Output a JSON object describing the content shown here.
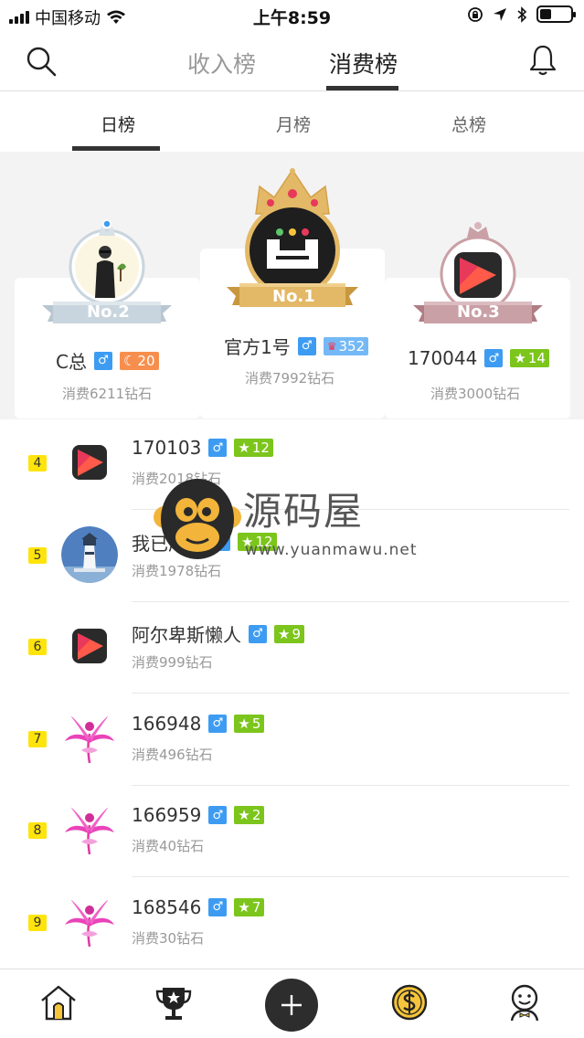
{
  "status_bar": {
    "carrier": "中国移动",
    "time": "上午8:59"
  },
  "header": {
    "tabs": [
      {
        "label": "收入榜"
      },
      {
        "label": "消费榜"
      }
    ],
    "active_tab": 1
  },
  "sub_tabs": [
    {
      "label": "日榜"
    },
    {
      "label": "月榜"
    },
    {
      "label": "总榜"
    }
  ],
  "podium": [
    {
      "rank_label": "No.1",
      "name": "官方1号",
      "gender": "♂",
      "level": "352",
      "level_color": "#74b9f6",
      "spend": "消费7992钻石"
    },
    {
      "rank_label": "No.2",
      "name": "C总",
      "gender": "♂",
      "level": "20",
      "level_color": "#f68f4d",
      "spend": "消费6211钻石"
    },
    {
      "rank_label": "No.3",
      "name": "170044",
      "gender": "♂",
      "level": "14",
      "level_color": "#7cc51c",
      "spend": "消费3000钻石"
    }
  ],
  "list": [
    {
      "rank": "4",
      "name": "170103",
      "gender": "♂",
      "level": "12",
      "spend": "消费2018钻石",
      "avatar": "play-logo"
    },
    {
      "rank": "5",
      "name": "我已成年",
      "gender": "♂",
      "level": "12",
      "spend": "消费1978钻石",
      "avatar": "lighthouse"
    },
    {
      "rank": "6",
      "name": "阿尔卑斯懒人",
      "gender": "♂",
      "level": "9",
      "spend": "消费999钻石",
      "avatar": "play-logo"
    },
    {
      "rank": "7",
      "name": "166948",
      "gender": "♂",
      "level": "5",
      "spend": "消费496钻石",
      "avatar": "flower"
    },
    {
      "rank": "8",
      "name": "166959",
      "gender": "♂",
      "level": "2",
      "spend": "消费40钻石",
      "avatar": "flower"
    },
    {
      "rank": "9",
      "name": "168546",
      "gender": "♂",
      "level": "7",
      "spend": "消费30钻石",
      "avatar": "flower"
    }
  ],
  "watermark": {
    "title": "源码屋",
    "url": "www.yuanmawu.net"
  },
  "colors": {
    "rank_badge": "#ffe40c",
    "gender_badge": "#3d9cf2",
    "level_badge": "#7cc51c",
    "gold": "#e3b866",
    "silver": "#c9d5de",
    "bronze": "#c9a0a6"
  }
}
